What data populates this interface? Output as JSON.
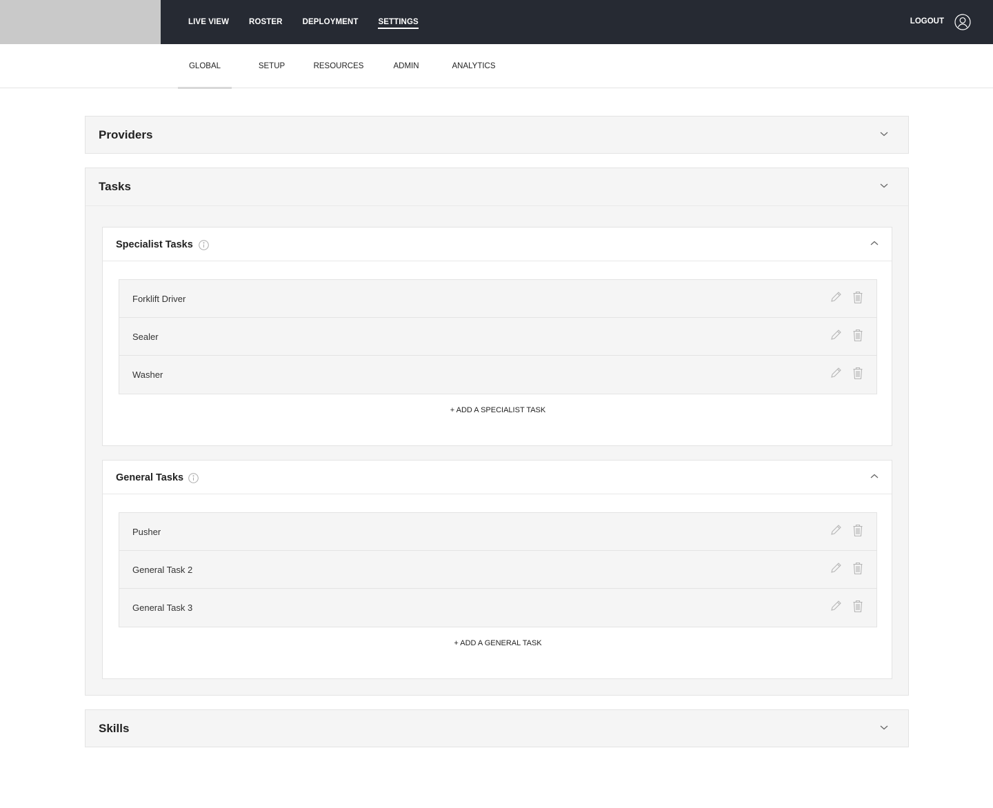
{
  "nav": {
    "items": [
      {
        "label": "LIVE VIEW"
      },
      {
        "label": "ROSTER"
      },
      {
        "label": "DEPLOYMENT"
      },
      {
        "label": "SETTINGS",
        "active": true
      }
    ],
    "logout_label": "LOGOUT",
    "user_icon": "user-circle-icon"
  },
  "subnav": {
    "tabs": [
      {
        "label": "GLOBAL",
        "active": true
      },
      {
        "label": "SETUP"
      },
      {
        "label": "RESOURCES"
      },
      {
        "label": "ADMIN"
      },
      {
        "label": "ANALYTICS"
      }
    ]
  },
  "sections": {
    "providers": {
      "title": "Providers",
      "expanded": false
    },
    "tasks": {
      "title": "Tasks",
      "expanded": true,
      "specialist": {
        "title": "Specialist Tasks",
        "items": [
          "Forklift Driver",
          "Sealer",
          "Washer"
        ],
        "add_label": "+ ADD A SPECIALIST TASK"
      },
      "general": {
        "title": "General Tasks",
        "items": [
          "Pusher",
          "General Task 2",
          "General Task 3"
        ],
        "add_label": "+ ADD A GENERAL TASK"
      }
    },
    "skills": {
      "title": "Skills",
      "expanded": false
    }
  },
  "colors": {
    "topbar": "#262a33",
    "panel_bg": "#f5f5f5",
    "icon_gray": "#b5b5b5"
  }
}
